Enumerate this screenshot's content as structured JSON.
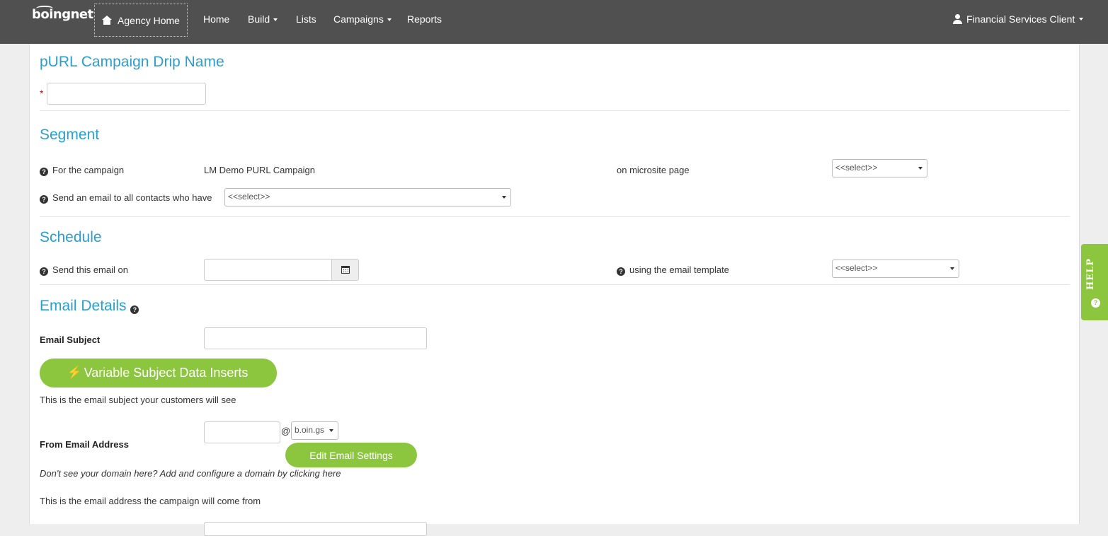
{
  "nav": {
    "logo": "boingnet",
    "agency_home": "Agency Home",
    "items": [
      {
        "label": "Home",
        "caret": false
      },
      {
        "label": "Build",
        "caret": true
      },
      {
        "label": "Lists",
        "caret": false
      },
      {
        "label": "Campaigns",
        "caret": true
      },
      {
        "label": "Reports",
        "caret": false
      }
    ],
    "user": "Financial Services Client"
  },
  "name_section": {
    "title": "pURL Campaign Drip Name",
    "required_marker": "*",
    "value": ""
  },
  "segment": {
    "title": "Segment",
    "for_campaign_label": "For the campaign",
    "campaign_name": "LM Demo PURL Campaign",
    "microsite_label": "on microsite page",
    "microsite_select": "<<select>>",
    "send_label": "Send an email to all contacts who have",
    "send_select": "<<select>>"
  },
  "schedule": {
    "title": "Schedule",
    "send_on_label": "Send this email on",
    "date_value": "",
    "template_label": "using the email template",
    "template_select": "<<select>>"
  },
  "email_details": {
    "title": "Email Details",
    "subject_label": "Email Subject",
    "subject_value": "",
    "variable_button": "Variable Subject Data Inserts",
    "subject_help": "This is the email subject your customers will see",
    "from_label": "From Email Address",
    "from_value": "",
    "at_sign": "@",
    "domain_select": "b.oin.gs",
    "edit_settings_button": "Edit Email Settings",
    "domain_note": "Don't see your domain here? Add and configure a domain by clicking here",
    "from_help": "This is the email address the campaign will come from"
  },
  "help_tab": {
    "label": "HELP"
  },
  "colors": {
    "navbar": "#505050",
    "accent_blue": "#2a9fd0",
    "green": "#8cc63f"
  }
}
